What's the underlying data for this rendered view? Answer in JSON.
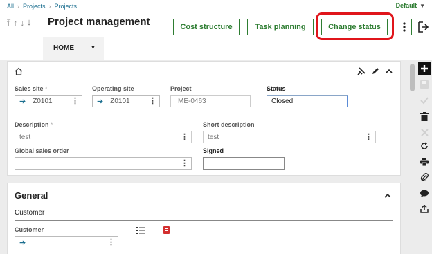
{
  "breadcrumb": {
    "items": [
      "All",
      "Projects",
      "Projects"
    ]
  },
  "user_menu": {
    "label": "Default"
  },
  "header": {
    "title": "Project management"
  },
  "actions": {
    "cost_structure": "Cost structure",
    "task_planning": "Task planning",
    "change_status": "Change status"
  },
  "home_tab": {
    "label": "HOME"
  },
  "fields": {
    "sales_site": {
      "label": "Sales site",
      "value": "Z0101",
      "required": "*"
    },
    "operating_site": {
      "label": "Operating site",
      "value": "Z0101"
    },
    "project": {
      "label": "Project",
      "value": "ME-0463"
    },
    "status": {
      "label": "Status",
      "value": "Closed"
    },
    "description": {
      "label": "Description",
      "value": "test",
      "required": "*"
    },
    "short_description": {
      "label": "Short description",
      "value": "test"
    },
    "global_sales_order": {
      "label": "Global sales order",
      "value": ""
    },
    "signed": {
      "label": "Signed",
      "value": ""
    }
  },
  "general": {
    "title": "General",
    "subsection": "Customer",
    "customer": {
      "label": "Customer",
      "value": ""
    }
  },
  "colors": {
    "accent": "#2e7d32",
    "highlight": "#e0151b",
    "link": "#1b6e8f"
  },
  "side_icons": [
    "plus-icon",
    "save-icon",
    "check-icon",
    "trash-icon",
    "close-icon",
    "refresh-icon",
    "print-icon",
    "attachment-icon",
    "comment-icon",
    "share-icon"
  ]
}
